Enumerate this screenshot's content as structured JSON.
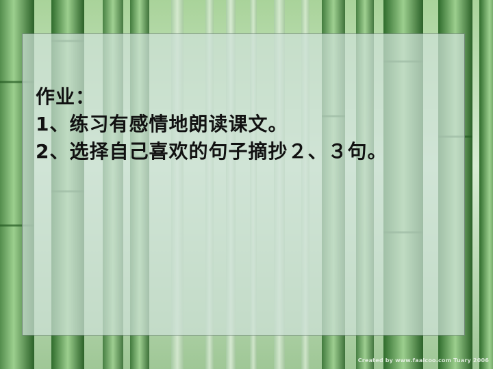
{
  "slide": {
    "heading": "作业：",
    "items": [
      "1、练习有感情地朗读课文。",
      "2、选择自己喜欢的句子摘抄２、３句。"
    ],
    "credit": "Created by www.faalcoo.com Tuary 2006"
  },
  "colors": {
    "panel": "#cde1d7",
    "text": "#111111",
    "bamboo_dark": "#3f7f3a",
    "bamboo_light": "#cfe6c9"
  }
}
